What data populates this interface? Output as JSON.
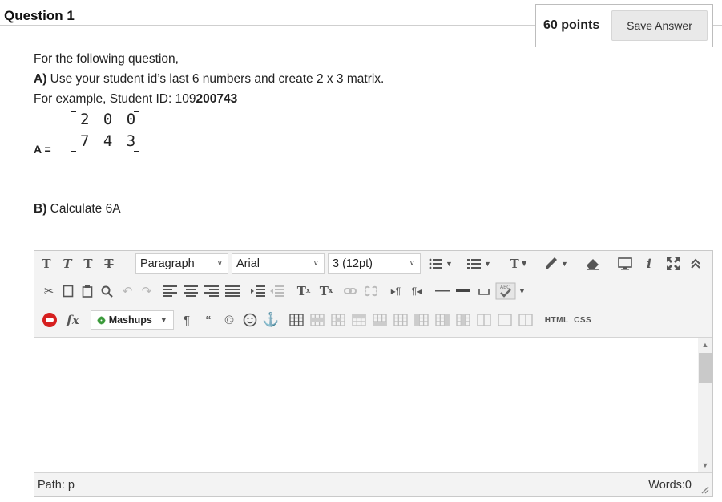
{
  "question": {
    "title": "Question 1",
    "points": "60 points",
    "save_label": "Save Answer"
  },
  "body": {
    "line1": "For the following question,",
    "partA_label": "A)",
    "partA_text": " Use your student id’s last 6 numbers and create 2 x 3 matrix.",
    "example_prefix": "For example, Student ID: 109",
    "example_bold": "200743",
    "matrix_label": "A =",
    "matrix_row1": "2 0 0",
    "matrix_row2": "7 4 3",
    "partB_label": "B)",
    "partB_text": " Calculate 6A"
  },
  "editor": {
    "toolbar": {
      "format_value": "Paragraph",
      "font_value": "Arial",
      "size_value": "3 (12pt)",
      "mashups_label": "Mashups",
      "html_label": "HTML",
      "css_label": "CSS",
      "text_t": "T",
      "italic_i": "i",
      "fx": "fx"
    },
    "status": {
      "path": "Path: p",
      "words": "Words:0"
    }
  },
  "colors": {
    "accent_red": "#d62020",
    "accent_green": "#3a9a3a",
    "accent_blue": "#2b6cc4",
    "toolbar_bg": "#f3f3f3"
  }
}
